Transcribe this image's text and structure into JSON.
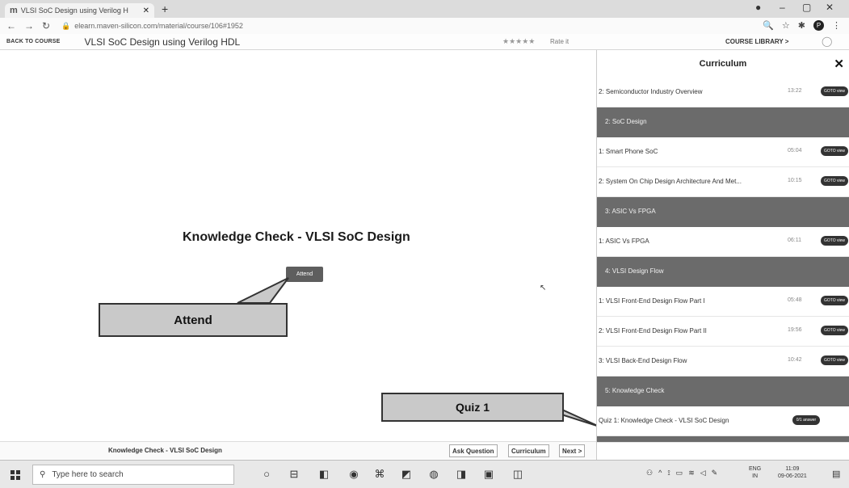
{
  "browser": {
    "tab_title": "VLSI SoC Design using Verilog H",
    "tab_favicon": "m",
    "new_tab": "+",
    "url": "elearn.maven-silicon.com/material/course/106#1952",
    "avatar_letter": "P"
  },
  "course_header": {
    "back": "BACK TO COURSE",
    "title": "VLSI SoC Design using Verilog HDL",
    "rate": "Rate it",
    "library": "COURSE LIBRARY >"
  },
  "main": {
    "knowledge_title": "Knowledge Check - VLSI SoC Design",
    "attend_button": "Attend",
    "callout_attend": "Attend",
    "callout_quiz": "Quiz 1"
  },
  "bottom_bar": {
    "title": "Knowledge Check - VLSI SoC Design",
    "ask": "Ask Question",
    "curriculum": "Curriculum",
    "next": "Next >"
  },
  "curriculum": {
    "title": "Curriculum",
    "rows": [
      {
        "label": "2: Semiconductor Industry Overview",
        "duration": "13:22",
        "badge": "GOTO view",
        "type": "item"
      },
      {
        "label": "2: SoC Design",
        "type": "section"
      },
      {
        "label": "1: Smart Phone SoC",
        "duration": "05:04",
        "badge": "GOTO view",
        "type": "item"
      },
      {
        "label": "2: System On Chip Design Architecture And Met...",
        "duration": "10:15",
        "badge": "GOTO view",
        "type": "item"
      },
      {
        "label": "3: ASIC Vs FPGA",
        "type": "section"
      },
      {
        "label": "1: ASIC Vs FPGA",
        "duration": "06:11",
        "badge": "GOTO view",
        "type": "item"
      },
      {
        "label": "4: VLSI Design Flow",
        "type": "section"
      },
      {
        "label": "1: VLSI Front-End Design Flow Part I",
        "duration": "05:48",
        "badge": "GOTO view",
        "type": "item"
      },
      {
        "label": "2: VLSI Front-End Design Flow Part II",
        "duration": "19:56",
        "badge": "GOTO view",
        "type": "item"
      },
      {
        "label": "3: VLSI Back-End Design Flow",
        "duration": "10:42",
        "badge": "GOTO view",
        "type": "item"
      },
      {
        "label": "5: Knowledge Check",
        "type": "section"
      },
      {
        "label": "Quiz 1: Knowledge Check - VLSI SoC Design",
        "badge": "0/1 answer",
        "type": "quiz"
      }
    ]
  },
  "taskbar": {
    "search_placeholder": "Type here to search",
    "lang_top": "ENG",
    "lang_bottom": "IN",
    "time": "11:09",
    "date": "09-06-2021"
  }
}
